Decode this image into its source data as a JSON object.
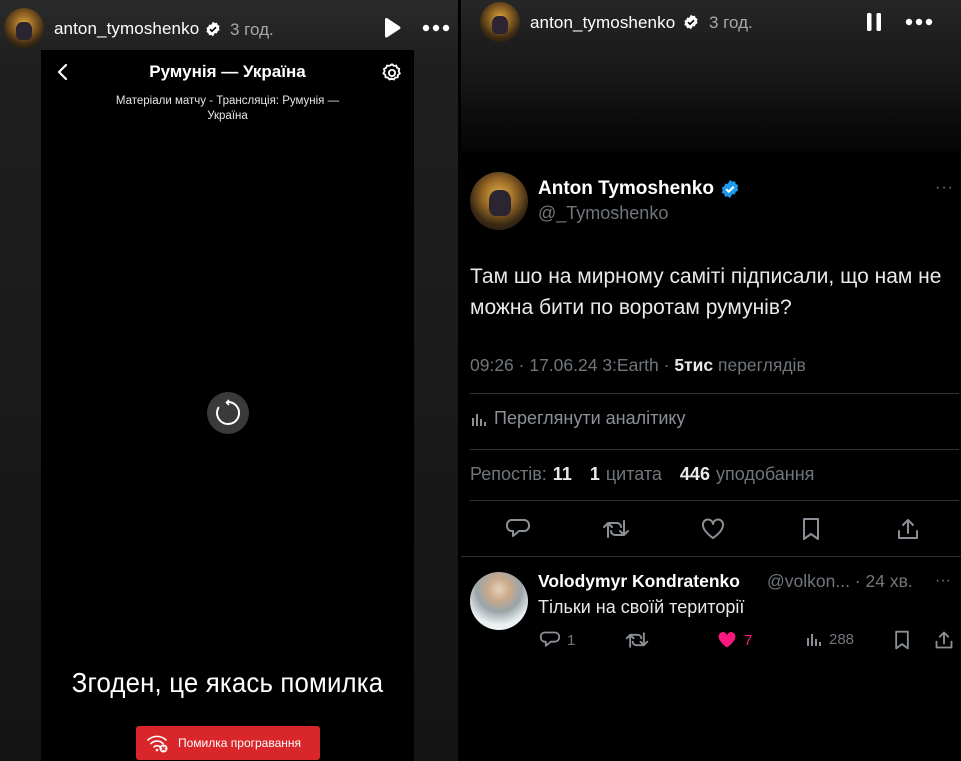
{
  "left_story": {
    "username": "anton_tymoshenko",
    "time": "3 год.",
    "play_icon": "play-icon",
    "more_icon": "more-icon"
  },
  "left_phone": {
    "title": "Румунія — Україна",
    "subtitle": "Матеріали матчу - Трансляція: Румунія — Україна",
    "caption": "Згоден, це якась помилка",
    "error_button": "Помилка програвання",
    "accent": "#d8262a"
  },
  "right_story": {
    "username": "anton_tymoshenko",
    "time": "3 год.",
    "pause_icon": "pause-icon",
    "more_icon": "more-icon"
  },
  "tweet": {
    "name": "Anton Tymoshenko",
    "handle": "@_Tymoshenko",
    "more": "···",
    "text": "Там шо на мирному саміті підписали, що нам не можна бити по воротам румунів?",
    "meta_prefix": "09:26 · 17.06.24 3:Earth · ",
    "views_count": "5тис",
    "views_label": "переглядів",
    "analytics": "Переглянути аналітику",
    "reposts_label": "Репостів:",
    "reposts_count": "11",
    "quotes_count": "1",
    "quotes_label": "цитата",
    "likes_count": "446",
    "likes_label": "уподобання",
    "verified_color": "#1d9bf0"
  },
  "reply": {
    "name": "Volodymyr Kondratenko",
    "handle": "@volkon... · 24 хв.",
    "more": "···",
    "text": "Тільки на своїй території",
    "reply_count": "1",
    "like_count": "7",
    "views_count": "288",
    "like_color": "#f91880"
  }
}
